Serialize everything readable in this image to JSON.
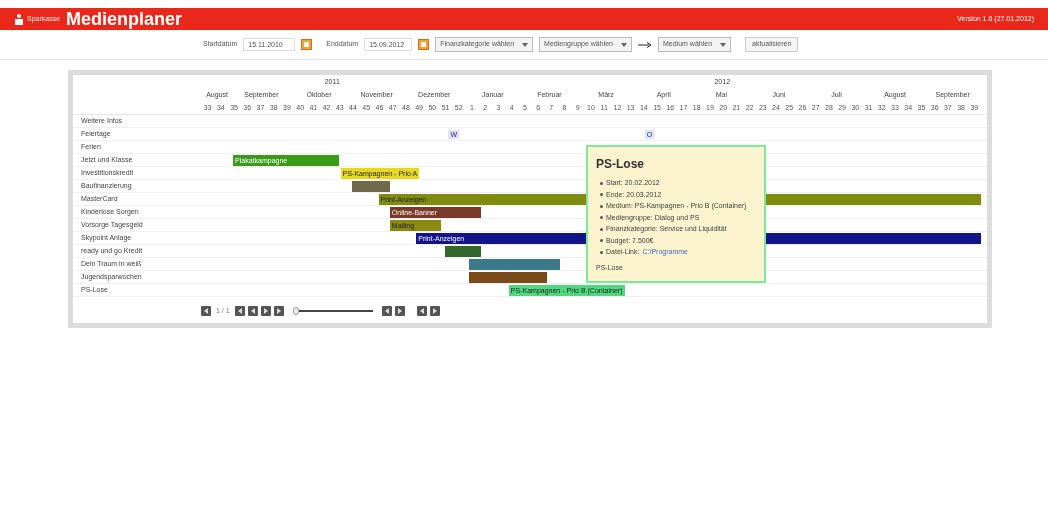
{
  "header": {
    "brand": "Sparkasse",
    "title": "Medienplaner",
    "version": "Version 1.6 (27.01.2012)"
  },
  "toolbar": {
    "start_label": "Startdatum",
    "start_value": "15.11.2010",
    "end_label": "Enddatum",
    "end_value": "15.09.2012",
    "finance_select": "Finanzkategorie wählen",
    "media_group_select": "Mediengruppe wählen",
    "medium_select": "Medium wählen",
    "update_button": "aktualisieren"
  },
  "timeline": {
    "years": [
      "2011",
      "2012"
    ],
    "months": [
      "August",
      "September",
      "Oktober",
      "November",
      "Dezember",
      "Januar",
      "Februar",
      "März",
      "April",
      "Mai",
      "Juni",
      "Juli",
      "August",
      "September"
    ],
    "weeks": [
      "33",
      "34",
      "35",
      "36",
      "37",
      "38",
      "39",
      "40",
      "41",
      "42",
      "43",
      "44",
      "45",
      "46",
      "47",
      "48",
      "49",
      "50",
      "51",
      "52",
      "1",
      "2",
      "3",
      "4",
      "5",
      "6",
      "7",
      "8",
      "9",
      "10",
      "11",
      "12",
      "13",
      "14",
      "15",
      "16",
      "17",
      "18",
      "19",
      "20",
      "21",
      "22",
      "23",
      "24",
      "25",
      "26",
      "27",
      "28",
      "29",
      "30",
      "31",
      "32",
      "33",
      "34",
      "35",
      "36",
      "37",
      "38",
      "39"
    ]
  },
  "rows": [
    {
      "label": "Weitere Infos",
      "kind": "info"
    },
    {
      "label": "Feiertage",
      "kind": "holiday",
      "markers": [
        "W",
        "O"
      ]
    },
    {
      "label": "Ferien",
      "kind": "holiday"
    },
    {
      "label": "Jetzt und Klasse",
      "kind": "bar",
      "color": "#3a9a1a",
      "text": "Plakatkampagne"
    },
    {
      "label": "Investitionskredit",
      "kind": "bar",
      "color": "#e8d820",
      "text": "PS-Kampagnen - Prio A"
    },
    {
      "label": "Baufinanzierung",
      "kind": "bar",
      "color": "#6f6a4a"
    },
    {
      "label": "MasterCard",
      "kind": "bar",
      "color": "#7f8c10",
      "text": "Print-Anzeigen"
    },
    {
      "label": "Kinderlose Sorgen",
      "kind": "bar",
      "color": "#7a3a2a",
      "text": "Online-Banner"
    },
    {
      "label": "Vorsorge Tagesgeld",
      "kind": "bar",
      "color": "#8a8a10",
      "text": "Mailing"
    },
    {
      "label": "Skypoint Anlage",
      "kind": "bar",
      "color": "#14148a",
      "text": "Print-Anzeigen"
    },
    {
      "label": "ready und go Kredit",
      "kind": "bar",
      "color": "#2f6a2a"
    },
    {
      "label": "Dein Traum in weiß",
      "kind": "bar",
      "color": "#3a7a8a"
    },
    {
      "label": "Jugendsparwochen",
      "kind": "bar",
      "color": "#7a4a1a"
    },
    {
      "label": "PS-Lose",
      "kind": "bar",
      "color": "#4ed880",
      "text": "PS-Kampagnen - Prio B (Container)"
    }
  ],
  "pager": {
    "page_text": "1 / 1",
    "zoom_slider": {
      "level": 0
    }
  },
  "tooltip": {
    "title": "PS-Lose",
    "items": [
      {
        "text": "Start: 20.02.2012"
      },
      {
        "text": "Ende: 20.03.2012"
      },
      {
        "text": "Medium: PS-Kampagnen - Prio B (Container)"
      },
      {
        "text": "Mediengruppe: Dialog und PS"
      },
      {
        "text": "Finanzkategorie: Service und Liquidität"
      },
      {
        "text": "Budget: 7.500€"
      },
      {
        "text": "Datei-Link:",
        "link": "C:\\Programme"
      }
    ],
    "footer": "PS-Lose"
  }
}
